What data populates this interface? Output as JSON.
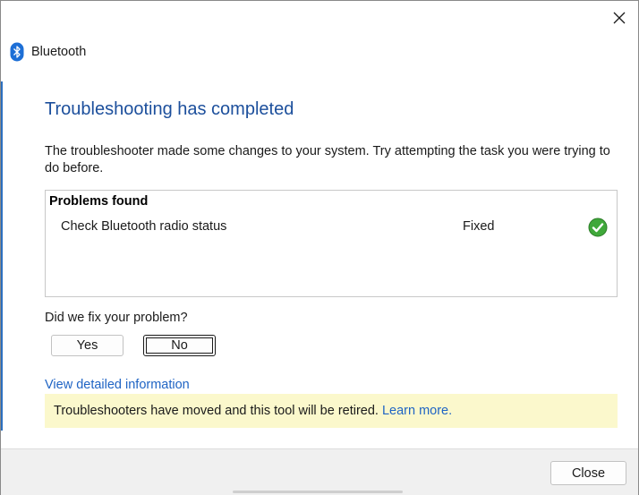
{
  "window": {
    "title": "Bluetooth",
    "close_icon": "close-icon"
  },
  "main": {
    "heading": "Troubleshooting has completed",
    "description": "The troubleshooter made some changes to your system. Try attempting the task you were trying to do before.",
    "results": {
      "header": "Problems found",
      "rows": [
        {
          "name": "Check Bluetooth radio status",
          "status": "Fixed",
          "icon": "green-check-icon"
        }
      ]
    },
    "question": "Did we fix your problem?",
    "yes_label": "Yes",
    "no_label": "No",
    "details_link": "View detailed information",
    "notice": {
      "text": "Troubleshooters have moved and this tool will be retired.",
      "link": "Learn more."
    }
  },
  "footer": {
    "close_label": "Close"
  },
  "colors": {
    "heading": "#1c4f9c",
    "link": "#1f64c4",
    "notice_bg": "#fbf8cc",
    "check_green": "#3fa83a",
    "footer_bg": "#f0f0f0"
  }
}
